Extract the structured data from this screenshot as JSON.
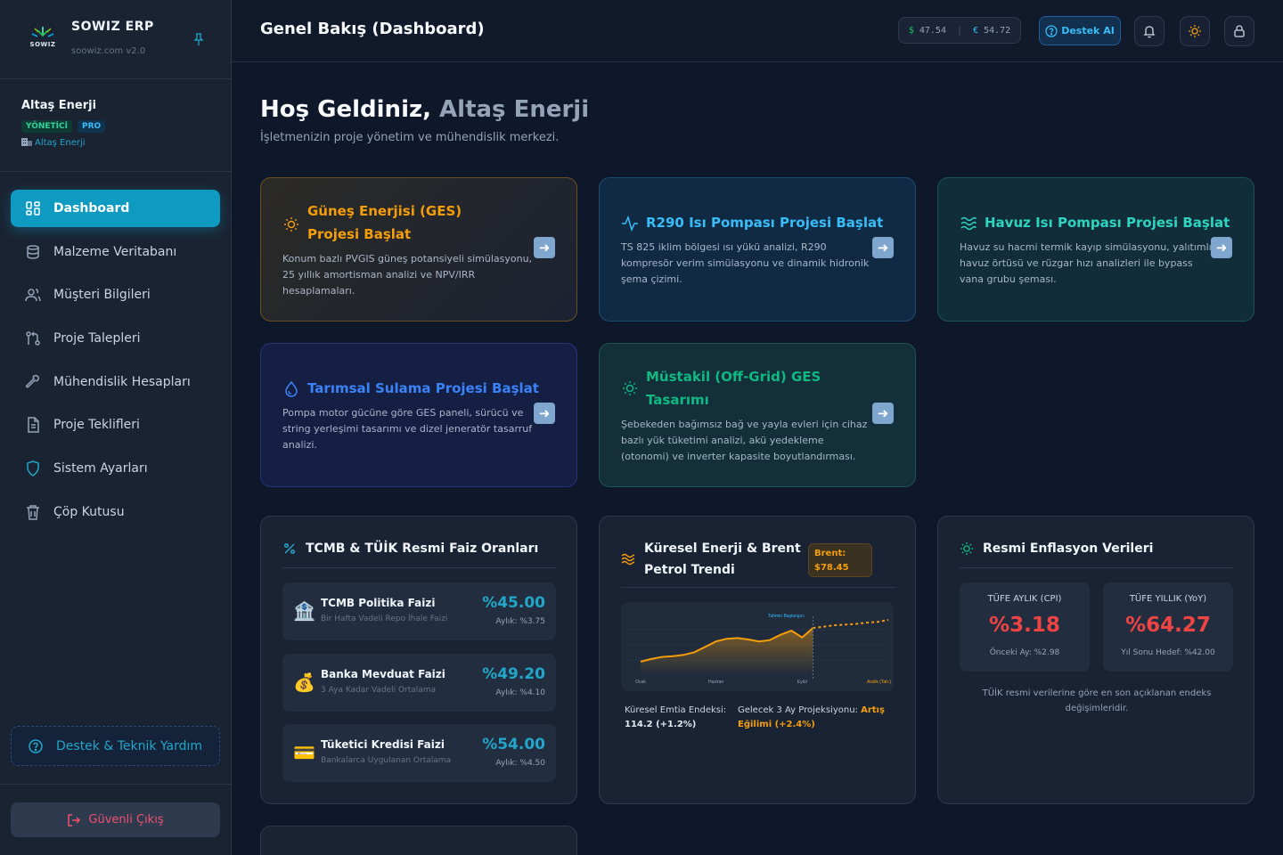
{
  "brand": {
    "name": "SOWIZ ERP",
    "sub": "soowiz.com v2.0",
    "logo_text": "SOWIZ"
  },
  "user": {
    "name": "Altaş Enerji",
    "role_badge": "YÖNETİCİ",
    "plan_badge": "PRO",
    "company": "Altaş Enerji"
  },
  "nav": [
    {
      "label": "Dashboard",
      "icon": "dashboard-icon",
      "active": true
    },
    {
      "label": "Malzeme Veritabanı",
      "icon": "database-icon"
    },
    {
      "label": "Müşteri Bilgileri",
      "icon": "users-icon"
    },
    {
      "label": "Proje Talepleri",
      "icon": "git-pull-icon"
    },
    {
      "label": "Mühendislik Hesapları",
      "icon": "wrench-icon"
    },
    {
      "label": "Proje Teklifleri",
      "icon": "document-icon"
    },
    {
      "label": "Sistem Ayarları",
      "icon": "shield-icon"
    },
    {
      "label": "Çöp Kutusu",
      "icon": "trash-icon"
    }
  ],
  "sidebar_footer": {
    "help_label": "Destek & Teknik Yardım",
    "logout_label": "Güvenli Çıkış"
  },
  "header": {
    "title": "Genel Bakış (Dashboard)",
    "usd_symbol": "$",
    "usd_value": "47.54",
    "eur_symbol": "€",
    "eur_value": "54.72",
    "ai_label": "Destek AI"
  },
  "welcome": {
    "prefix": "Hoş Geldiniz, ",
    "name": "Altaş Enerji",
    "subtitle": "İşletmenizin proje yönetim ve mühendislik merkezi."
  },
  "projects": [
    {
      "title": "Güneş Enerjisi (GES) Projesi Başlat",
      "desc": "Konum bazlı PVGIS güneş potansiyeli simülasyonu, 25 yıllık amortisman analizi ve NPV/IRR hesaplamaları.",
      "color": "#f59e0b",
      "icon": "sun-icon"
    },
    {
      "title": "R290 Isı Pompası Projesi Başlat",
      "desc": "TS 825 iklim bölgesi ısı yükü analizi, R290 kompresör verim simülasyonu ve dinamik hidronik şema çizimi.",
      "color": "#38bdf8",
      "icon": "activity-icon"
    },
    {
      "title": "Havuz Isı Pompası Projesi Başlat",
      "desc": "Havuz su hacmi termik kayıp simülasyonu, yalıtımlı havuz örtüsü ve rüzgar hızı analizleri ile bypass vana grubu şeması.",
      "color": "#2dd4bf",
      "icon": "waves-icon"
    },
    {
      "title": "Tarımsal Sulama Projesi Başlat",
      "desc": "Pompa motor gücüne göre GES paneli, sürücü ve string yerleşimi tasarımı ve dizel jeneratör tasarruf analizi.",
      "color": "#3b82f6",
      "icon": "droplet-icon"
    },
    {
      "title": "Müstakil (Off-Grid) GES Tasarımı",
      "desc": "Şebekeden bağımsız bağ ve yayla evleri için cihaz bazlı yük tüketimi analizi, akü yedekleme (otonomi) ve inverter kapasite boyutlandırması.",
      "color": "#10b981",
      "icon": "sun-icon"
    }
  ],
  "rates": {
    "title": "TCMB & TÜİK Resmi Faiz Oranları",
    "items": [
      {
        "emoji": "🏦",
        "name": "TCMB Politika Faizi",
        "desc": "Bir Hafta Vadeli Repo İhale Faizi",
        "value": "%45.00",
        "monthly": "Aylık: %3.75"
      },
      {
        "emoji": "💰",
        "name": "Banka Mevduat Faizi",
        "desc": "3 Aya Kadar Vadeli Ortalama",
        "value": "%49.20",
        "monthly": "Aylık: %4.10"
      },
      {
        "emoji": "💳",
        "name": "Tüketici Kredisi Faizi",
        "desc": "Bankalarca Uygulanan Ortalama",
        "value": "%54.00",
        "monthly": "Aylık: %4.50"
      }
    ]
  },
  "energy": {
    "title": "Küresel Enerji & Brent Petrol Trendi",
    "brent_label": "Brent:",
    "brent_value": "$78.45",
    "index_label": "Küresel Emtia Endeksi:",
    "index_value": "114.2 (+1.2%)",
    "projection_label": "Gelecek 3 Ay Projeksiyonu:",
    "projection_value": "Artış Eğilimi (+2.4%)"
  },
  "chart_data": {
    "type": "line",
    "annotation": "Tahmin Başlangıcı",
    "x_labels": [
      "Ocak",
      "Haziran",
      "Eylül",
      "Aralık (Tah.)"
    ],
    "series": [
      {
        "values": [
          20,
          24,
          27,
          28,
          30,
          34,
          42,
          50,
          54,
          55,
          53,
          50,
          52,
          60,
          66,
          56,
          70,
          72,
          74,
          75,
          76,
          78,
          79,
          82
        ]
      }
    ],
    "forecast_start_index": 16
  },
  "inflation": {
    "title": "Resmi Enflasyon Verileri",
    "monthly_label": "TÜFE AYLIK (CPI)",
    "monthly_value": "%3.18",
    "monthly_note": "Önceki Ay: %2.98",
    "yearly_label": "TÜFE YILLIK (YoY)",
    "yearly_value": "%64.27",
    "yearly_note": "Yıl Sonu Hedef: %42.00",
    "footer": "TÜİK resmi verilerine göre en son açıklanan endeks değişimleridir."
  }
}
